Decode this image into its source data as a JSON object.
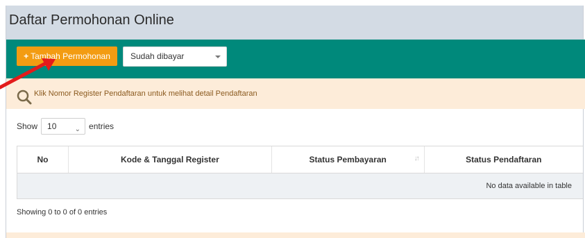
{
  "header": {
    "title": "Daftar Permohonan Online"
  },
  "toolbar": {
    "add_button_icon": "+",
    "add_button_label": "Tambah Permohonan",
    "status_select_value": "Sudah dibayar"
  },
  "info": {
    "message": "Klik Nomor Register Pendaftaran untuk melihat detail Pendaftaran"
  },
  "table_controls": {
    "show_label": "Show",
    "entries_value": "10",
    "entries_label": "entries"
  },
  "table": {
    "columns": [
      "No",
      "Kode & Tanggal Register",
      "Status Pembayaran",
      "Status Pendaftaran"
    ],
    "empty_message": "No data available in table"
  },
  "footer": {
    "showing_text": "Showing 0 to 0 of 0 entries"
  },
  "colors": {
    "accent": "#00897b",
    "button": "#f39c12",
    "info_bg": "#fdecd9",
    "header_bg": "#d3dbe4",
    "arrow": "#e31b1b"
  },
  "icons": {
    "info_icon": "search-icon",
    "sort_icon": "sort-icon",
    "select_caret": "chevron-down-icon"
  }
}
